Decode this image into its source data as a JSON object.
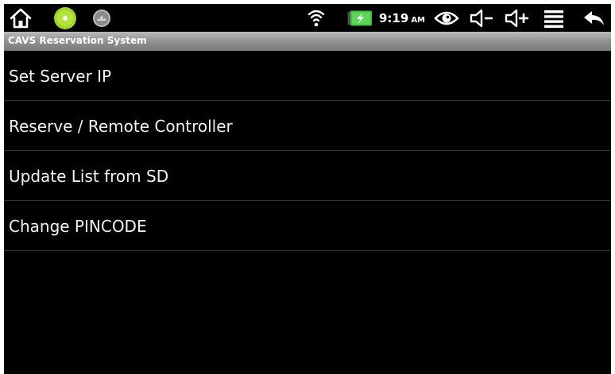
{
  "status_bar": {
    "time": "9:19",
    "ampm": "AM",
    "icons": [
      "home-icon",
      "android-notification-icon",
      "usb-debug-icon",
      "wifi-icon",
      "battery-charging-icon",
      "eye-icon",
      "volume-down-icon",
      "volume-up-icon",
      "menu-icon",
      "back-icon"
    ]
  },
  "app": {
    "title": "CAVS Reservation System"
  },
  "menu": {
    "items": [
      {
        "label": "Set Server IP"
      },
      {
        "label": "Reserve / Remote Controller"
      },
      {
        "label": "Update List from SD"
      },
      {
        "label": "Change PINCODE"
      }
    ]
  },
  "colors": {
    "background": "#000000",
    "title_bar": "#8e8e8e",
    "text": "#f2f2f2",
    "accent_green": "#9dd627",
    "battery_green": "#3ec23a"
  }
}
